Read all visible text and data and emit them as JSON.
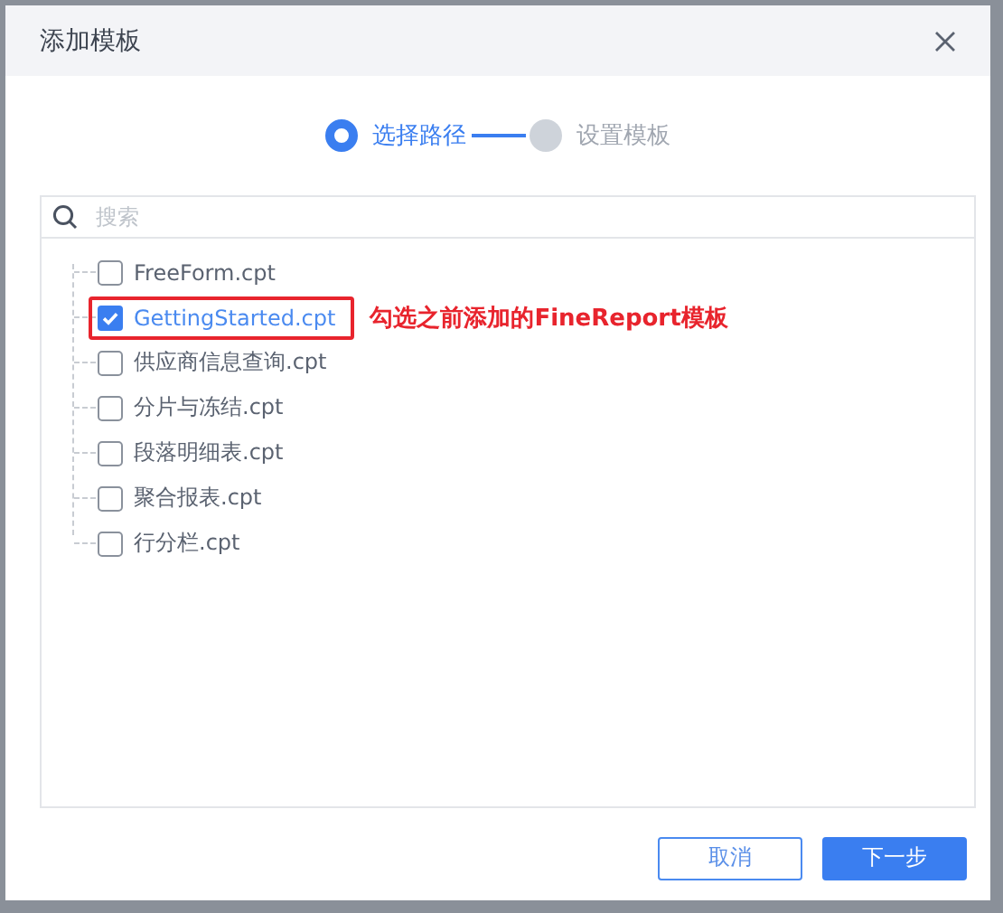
{
  "dialog": {
    "title": "添加模板"
  },
  "steps": [
    {
      "label": "选择路径",
      "active": true
    },
    {
      "label": "设置模板",
      "active": false
    }
  ],
  "search": {
    "placeholder": "搜索"
  },
  "files": [
    {
      "label": "FreeForm.cpt",
      "checked": false,
      "highlighted": false
    },
    {
      "label": "GettingStarted.cpt",
      "checked": true,
      "highlighted": true
    },
    {
      "label": "供应商信息查询.cpt",
      "checked": false,
      "highlighted": false
    },
    {
      "label": "分片与冻结.cpt",
      "checked": false,
      "highlighted": false
    },
    {
      "label": "段落明细表.cpt",
      "checked": false,
      "highlighted": false
    },
    {
      "label": "聚合报表.cpt",
      "checked": false,
      "highlighted": false
    },
    {
      "label": "行分栏.cpt",
      "checked": false,
      "highlighted": false
    }
  ],
  "annotation": "勾选之前添加的FineReport模板",
  "buttons": [
    {
      "label": "取消",
      "kind": "secondary"
    },
    {
      "label": "下一步",
      "kind": "primary"
    }
  ]
}
